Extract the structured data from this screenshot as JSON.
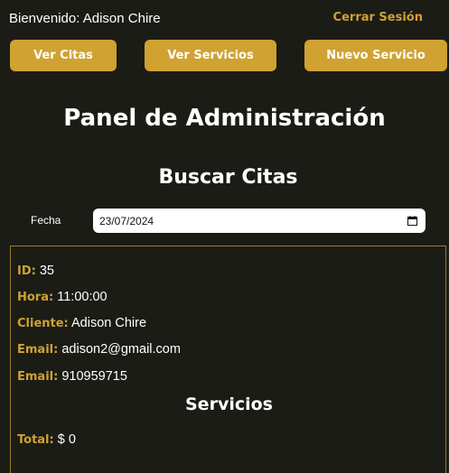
{
  "header": {
    "welcome_text": "Bienvenido: Adison Chire",
    "logout_label": "Cerrar Sesión"
  },
  "nav": {
    "buttons": [
      {
        "label": "Ver Citas"
      },
      {
        "label": "Ver Servicios"
      },
      {
        "label": "Nuevo Servicio"
      }
    ]
  },
  "main": {
    "title": "Panel de Administración",
    "search_title": "Buscar Citas",
    "date_label": "Fecha",
    "date_value": "23/07/2024"
  },
  "appointment": {
    "id_label": "ID:",
    "id_value": "35",
    "time_label": "Hora:",
    "time_value": "11:00:00",
    "client_label": "Cliente:",
    "client_value": "Adison Chire",
    "email_label": "Email:",
    "email_value": "adison2@gmail.com",
    "phone_label": "Email:",
    "phone_value": "910959715",
    "services_title": "Servicios",
    "total_label": "Total:",
    "total_value": "$ 0"
  },
  "colors": {
    "background": "#1c1c17",
    "accent": "#cfa232",
    "text": "#ffffff"
  },
  "icons": {
    "date_picker": "calendar-icon"
  }
}
